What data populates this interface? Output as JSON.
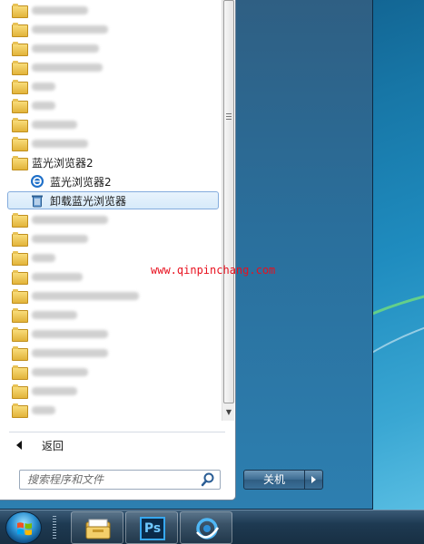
{
  "start_menu": {
    "programs": [
      {
        "type": "folder",
        "label": "",
        "blurred": true,
        "blur_w": 62
      },
      {
        "type": "folder",
        "label": "",
        "blurred": true,
        "blur_w": 84
      },
      {
        "type": "folder",
        "label": "",
        "blurred": true,
        "blur_w": 74
      },
      {
        "type": "folder",
        "label": "",
        "blurred": true,
        "blur_w": 78
      },
      {
        "type": "folder",
        "label": "",
        "blurred": true,
        "blur_w": 26
      },
      {
        "type": "folder",
        "label": "",
        "blurred": true,
        "blur_w": 26
      },
      {
        "type": "folder",
        "label": "",
        "blurred": true,
        "blur_w": 50
      },
      {
        "type": "folder",
        "label": "",
        "blurred": true,
        "blur_w": 62
      },
      {
        "type": "folder",
        "label": "蓝光浏览器2",
        "blurred": false
      },
      {
        "type": "app",
        "icon": "ie-icon",
        "label": "蓝光浏览器2",
        "blurred": false
      },
      {
        "type": "app",
        "icon": "recycle-bin-icon",
        "label": "卸载蓝光浏览器",
        "blurred": false,
        "selected": true
      },
      {
        "type": "folder",
        "label": "",
        "blurred": true,
        "blur_w": 84
      },
      {
        "type": "folder",
        "label": "",
        "blurred": true,
        "blur_w": 62
      },
      {
        "type": "folder",
        "label": "",
        "blurred": true,
        "blur_w": 26
      },
      {
        "type": "folder",
        "label": "",
        "blurred": true,
        "blur_w": 56
      },
      {
        "type": "folder",
        "label": "",
        "blurred": true,
        "blur_w": 118
      },
      {
        "type": "folder",
        "label": "",
        "blurred": true,
        "blur_w": 50
      },
      {
        "type": "folder",
        "label": "",
        "blurred": true,
        "blur_w": 84
      },
      {
        "type": "folder",
        "label": "",
        "blurred": true,
        "blur_w": 84
      },
      {
        "type": "folder",
        "label": "",
        "blurred": true,
        "blur_w": 62
      },
      {
        "type": "folder",
        "label": "",
        "blurred": true,
        "blur_w": 50
      },
      {
        "type": "folder",
        "label": "",
        "blurred": true,
        "blur_w": 26
      }
    ],
    "back_label": "返回",
    "search_placeholder": "搜索程序和文件",
    "shutdown_label": "关机"
  },
  "watermark": "www.qinpinchang.com",
  "taskbar": {
    "items": [
      "explorer-icon",
      "photoshop-icon",
      "browser-icon"
    ],
    "ps_label": "Ps"
  }
}
